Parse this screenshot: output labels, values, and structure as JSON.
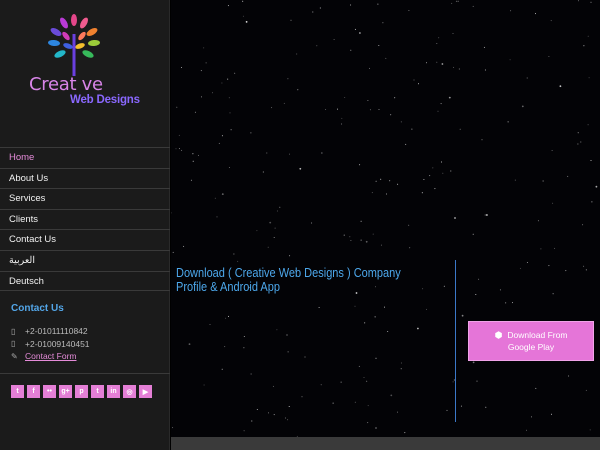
{
  "logo": {
    "line1": "Creat ve",
    "line2": "Web Designs"
  },
  "nav": [
    {
      "label": "Home",
      "active": true
    },
    {
      "label": "About Us"
    },
    {
      "label": "Services"
    },
    {
      "label": "Clients"
    },
    {
      "label": "Contact Us"
    },
    {
      "label": "العربية"
    },
    {
      "label": "Deutsch"
    }
  ],
  "contact": {
    "title": "Contact Us",
    "phone1": "+2-01011110842",
    "phone2": "+2-01009140451",
    "form_link": "Contact Form"
  },
  "social": [
    "twitter-icon",
    "facebook-icon",
    "flickr-icon",
    "google-plus-icon",
    "pinterest-icon",
    "tumblr-icon",
    "linkedin-icon",
    "instagram-icon",
    "youtube-icon"
  ],
  "social_glyphs": [
    "t",
    "f",
    "••",
    "g+",
    "p",
    "t",
    "in",
    "◎",
    "▶"
  ],
  "main": {
    "headline": "Download ( Creative Web Designs ) Company Profile & Android App",
    "download_line1": "Download From",
    "download_line2": "Google Play"
  },
  "colors": {
    "accent": "#e575d8",
    "link_blue": "#4da8ec",
    "sidebar_bg": "#1b1b1b"
  }
}
